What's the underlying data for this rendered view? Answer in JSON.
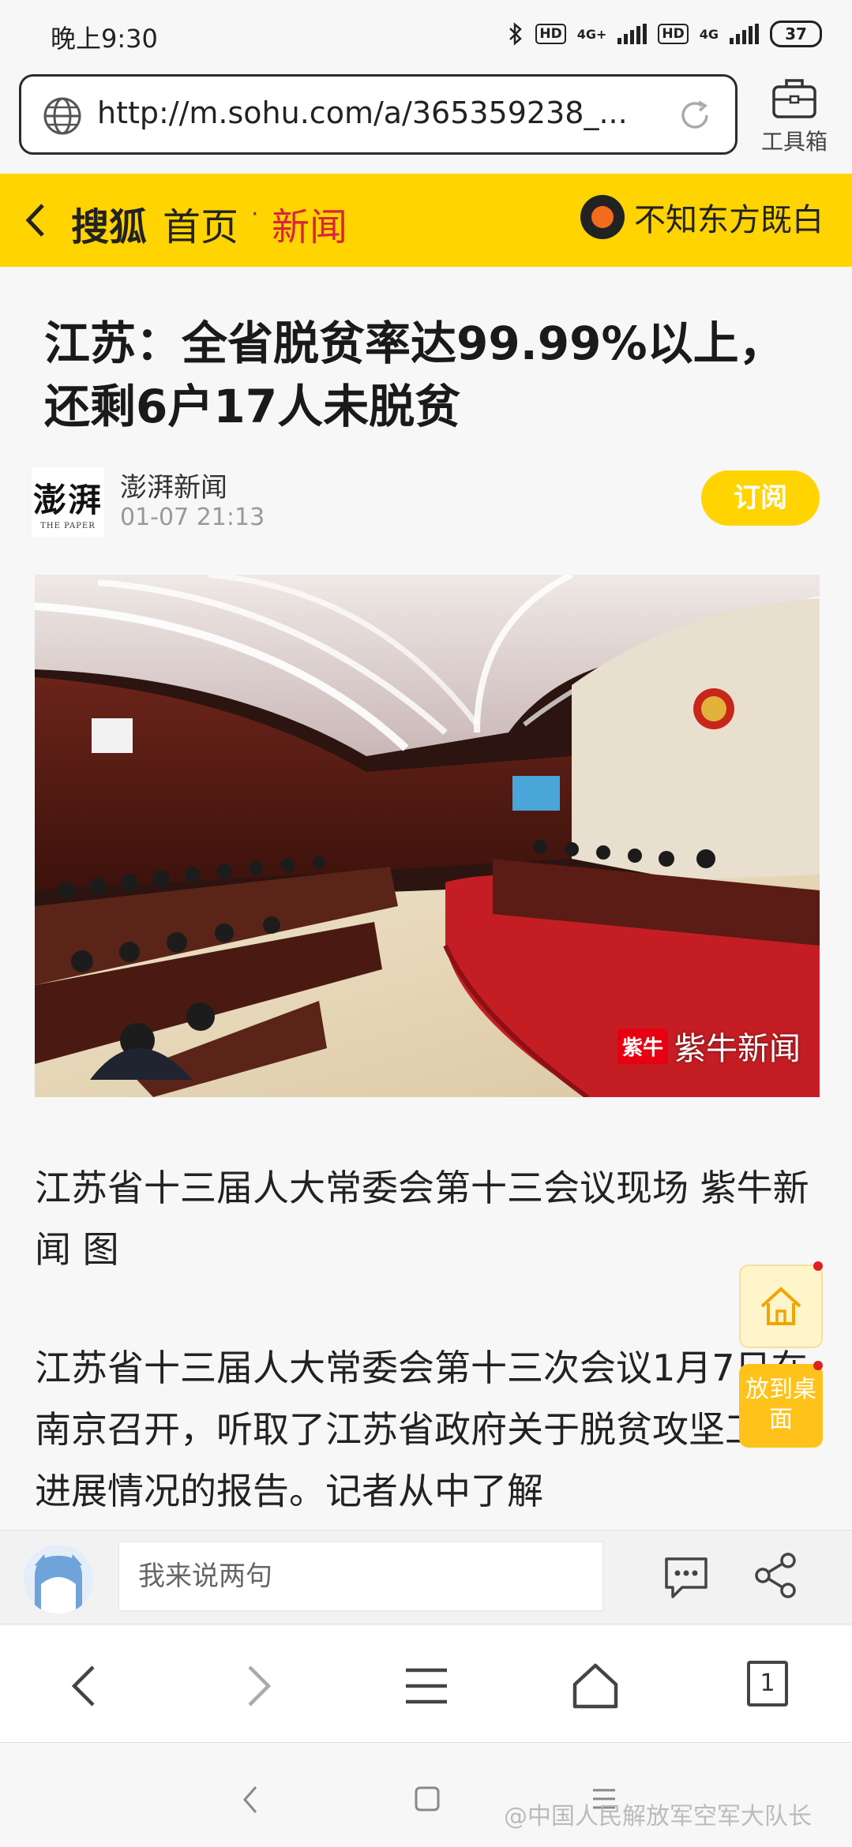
{
  "status_bar": {
    "time": "晚上9:30",
    "hd1": "HD",
    "net1": "4G+",
    "hd2": "HD",
    "net2": "4G",
    "battery": "37"
  },
  "browser": {
    "url": "http://m.sohu.com/a/365359238_...",
    "toolbox_label": "工具箱"
  },
  "nav": {
    "brand": "搜狐",
    "home": "首页",
    "separator": "·",
    "channel": "新闻",
    "author": "不知东方既白"
  },
  "article": {
    "title": "江苏：全省脱贫率达99.99%以上，还剩6户17人未脱贫",
    "source_logo_text": "澎湃",
    "source_logo_sub": "THE PAPER",
    "source": "澎湃新闻",
    "time": "01-07 21:13",
    "subscribe_label": "订阅",
    "photo_watermark_box": "紫牛",
    "photo_watermark_text": "紫牛新闻",
    "caption": "江苏省十三届人大常委会第十三会议现场 紫牛新闻 图",
    "paragraph": "江苏省十三届人大常委会第十三次会议1月7日在南京召开，听取了江苏省政府关于脱贫攻坚工作进展情况的报告。记者从中了解"
  },
  "floating": {
    "desktop_label": "放到桌面"
  },
  "comment": {
    "placeholder": "我来说两句"
  },
  "browser_nav": {
    "tab_count": "1"
  },
  "watermark": "@中国人民解放军空军大队长",
  "colors": {
    "accent_yellow": "#ffd400",
    "channel_red": "#d7263d",
    "desk_button": "#ffc21a"
  },
  "icons": [
    "globe-icon",
    "reload-icon",
    "toolbox-icon",
    "back-chevron-icon",
    "author-logo-icon",
    "home-icon",
    "chat-icon",
    "share-icon",
    "back-icon",
    "forward-icon",
    "menu-icon",
    "browser-home-icon",
    "tabs-icon"
  ]
}
